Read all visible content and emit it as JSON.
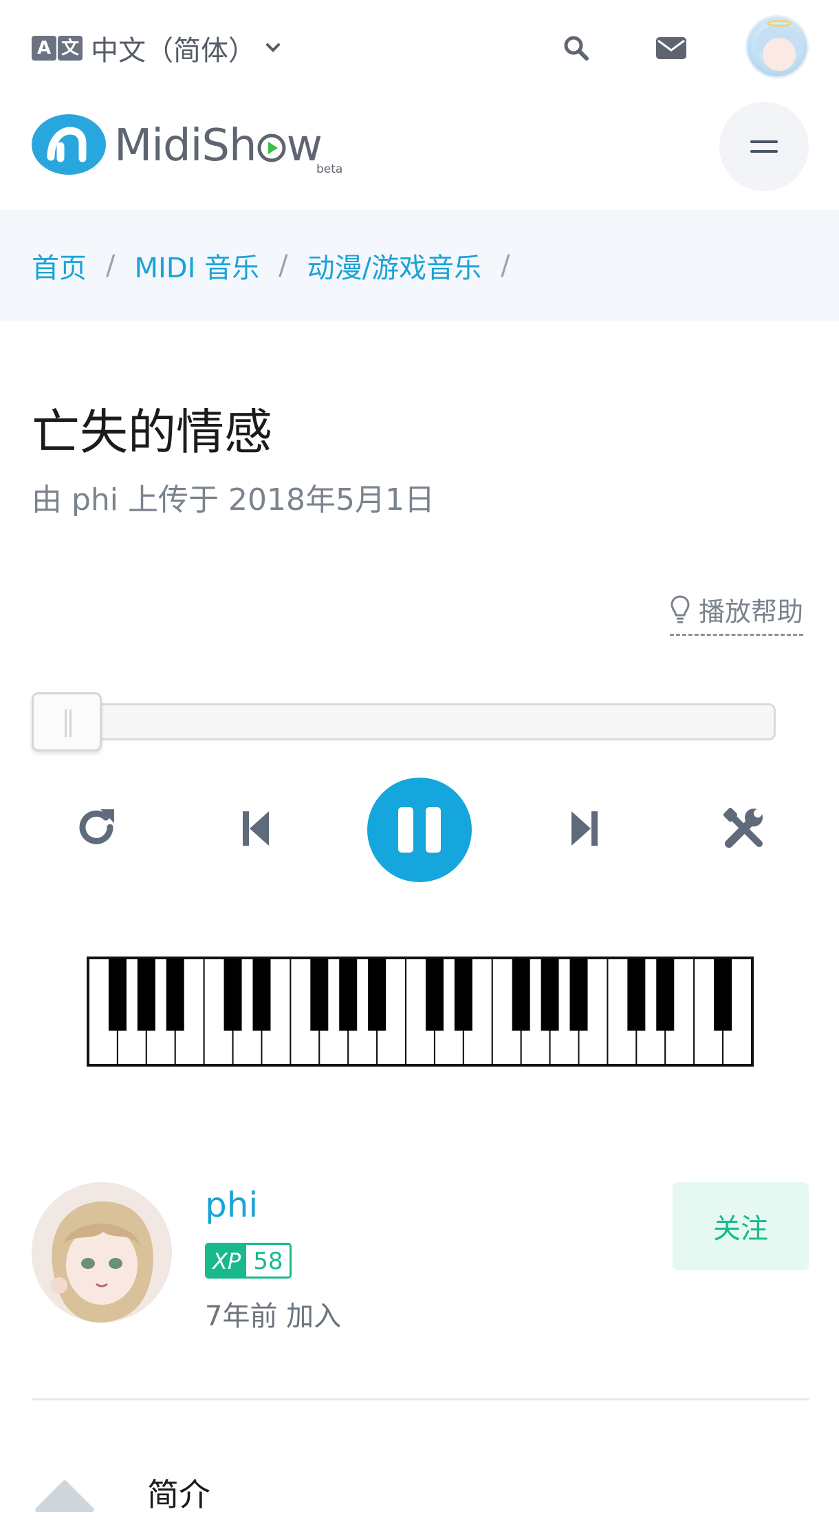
{
  "topbar": {
    "language_icon_a": "A",
    "language_icon_b": "文",
    "language_label": "中文（简体）"
  },
  "logo": {
    "wordmark_left": "MidiSh",
    "wordmark_right": "w",
    "beta": "beta",
    "brand_color": "#2aa6df",
    "play_color": "#3cbf4a"
  },
  "breadcrumb": {
    "items": [
      "首页",
      "MIDI 音乐",
      "动漫/游戏音乐"
    ],
    "separator": "/"
  },
  "song": {
    "title": "亡失的情感",
    "meta": "由 phi 上传于 2018年5月1日"
  },
  "player": {
    "help_label": "播放帮助",
    "progress": 0.0,
    "state": "playing",
    "accent_color": "#14a6dd"
  },
  "author": {
    "name": "phi",
    "xp_label": "XP",
    "xp_value": "58",
    "joined": "7年前 加入",
    "follow_label": "关注"
  },
  "intro": {
    "label": "简介"
  }
}
